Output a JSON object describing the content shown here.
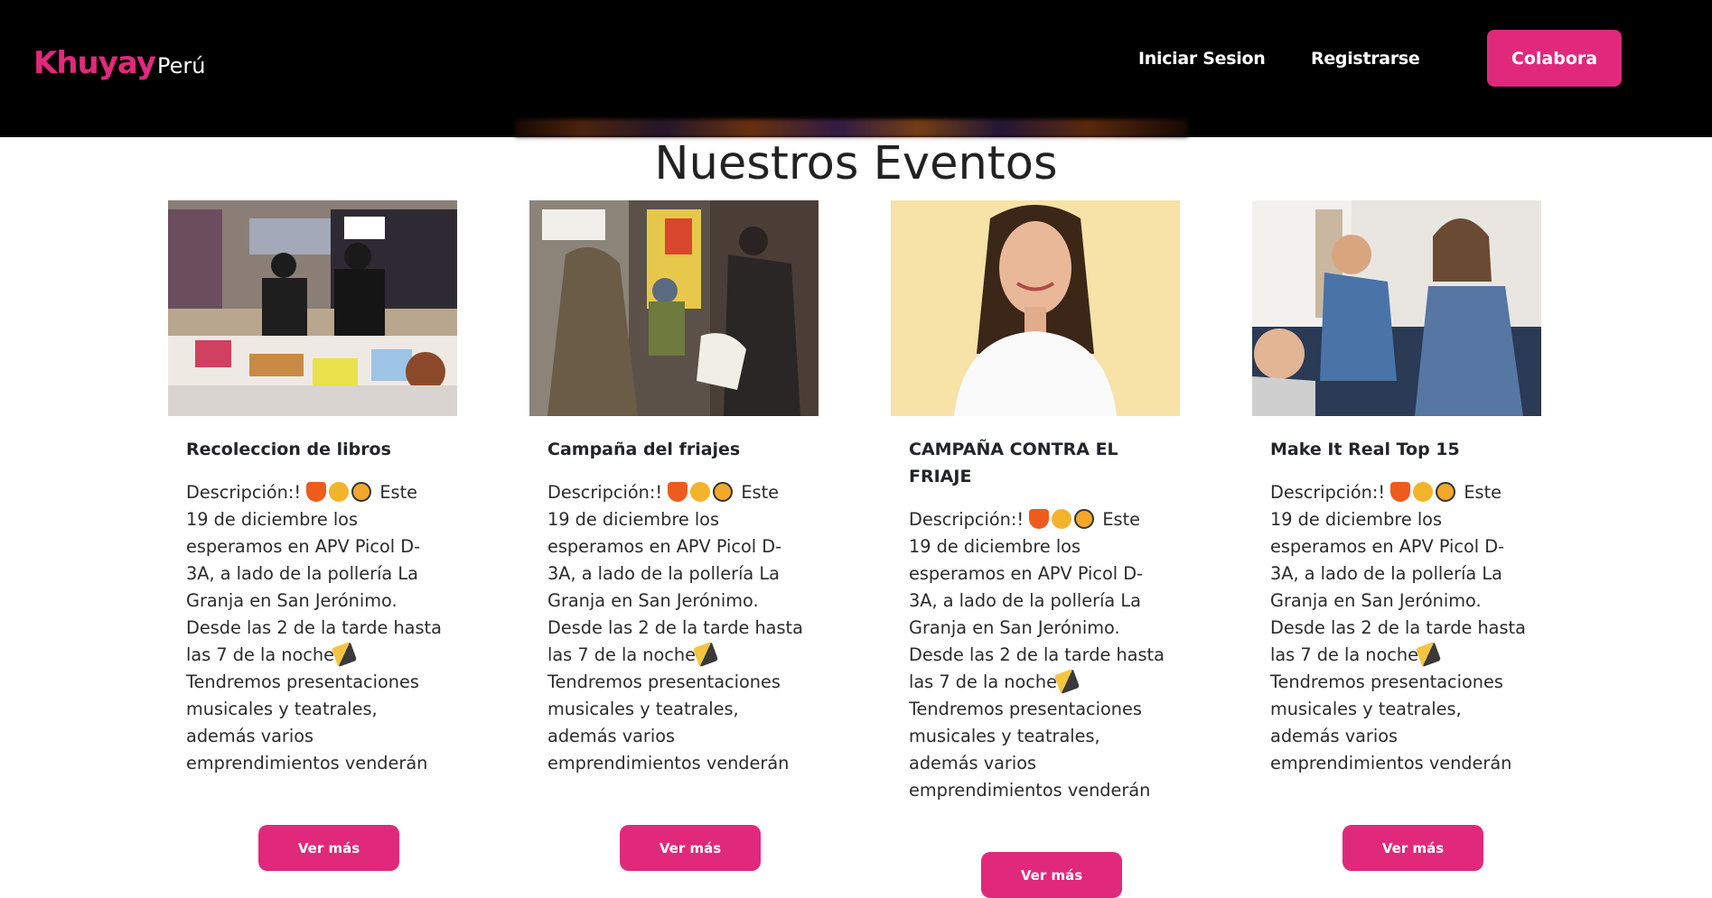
{
  "nav": {
    "logo_main": "Khuyay",
    "logo_sub": "Perú",
    "login_label": "Iniciar Sesion",
    "register_label": "Registrarse",
    "collab_label": "Colabora"
  },
  "colors": {
    "accent": "#e0297b",
    "nav_bg": "#000000"
  },
  "section": {
    "title": "Nuestros Eventos"
  },
  "events": [
    {
      "title": "Recoleccion de libros",
      "desc_start": "Descripción:! ",
      "desc_mid": "Este 19 de diciembre los esperamos en APV Picol D-3A, a lado de la pollería La Granja en San Jerónimo. Desde las 2 de la tarde hasta las 7 de la noche",
      "desc_end": "Tendremos presentaciones musicales y teatrales, además varios emprendimientos venderán sus productos. Puedes donar útiles escolares, libros y juguetes. Habrán muchas sorpresas",
      "button": "Ver más",
      "image": "people-at-event-table-photo"
    },
    {
      "title": "Campaña del friajes",
      "desc_start": "Descripción:! ",
      "desc_mid": "Este 19 de diciembre los esperamos en APV Picol D-3A, a lado de la pollería La Granja en San Jerónimo. Desde las 2 de la tarde hasta las 7 de la noche",
      "desc_end": "Tendremos presentaciones musicales y teatrales, además varios emprendimientos venderán sus productos. Puedes donar útiles escolares, libros y juguetes. Habrán muchas sorpresas",
      "button": "Ver más",
      "image": "donation-to-child-photo"
    },
    {
      "title": "CAMPAÑA CONTRA EL FRIAJE",
      "desc_start": "Descripción:! ",
      "desc_mid": "Este 19 de diciembre los esperamos en APV Picol D-3A, a lado de la pollería La Granja en San Jerónimo. Desde las 2 de la tarde hasta las 7 de la noche",
      "desc_end": "Tendremos presentaciones musicales y teatrales, además varios emprendimientos venderán sus productos. Puedes donar útiles escolares, libros y juguetes. Habrán muchas sorpresas",
      "button": "Ver más",
      "image": "smiling-woman-portrait-photo"
    },
    {
      "title": "Make It Real Top 15",
      "desc_start": "Descripción:! ",
      "desc_mid": "Este 19 de diciembre los esperamos en APV Picol D-3A, a lado de la pollería La Granja en San Jerónimo. Desde las 2 de la tarde hasta las 7 de la noche",
      "desc_end": "Tendremos presentaciones musicales y teatrales, además varios emprendimientos venderán sus productos. Puedes donar útiles escolares, libros y juguetes. Habrán muchas sorpresas",
      "button": "Ver más",
      "image": "group-of-young-people-photo"
    }
  ]
}
